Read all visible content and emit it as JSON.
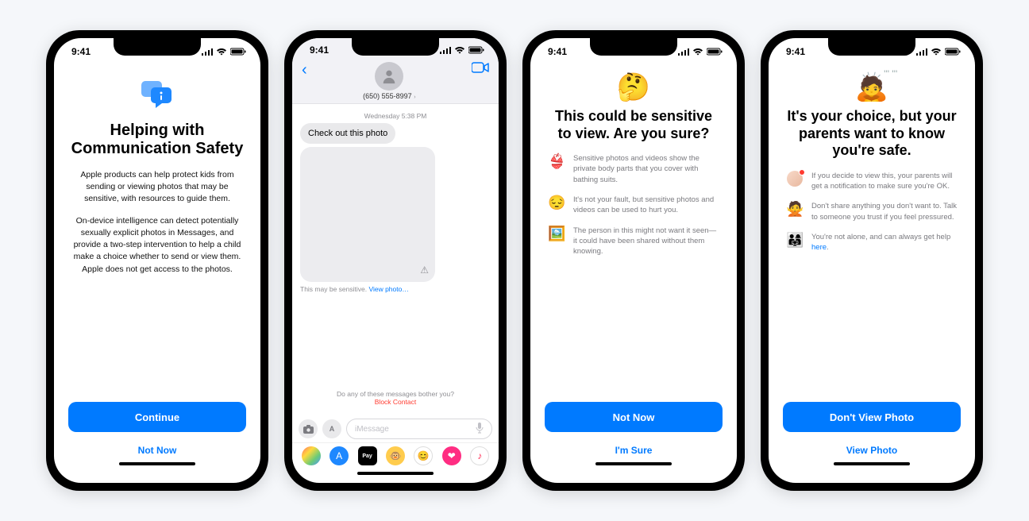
{
  "status": {
    "time": "9:41"
  },
  "screen1": {
    "title": "Helping with Communication Safety",
    "body1": "Apple products can help protect kids from sending or viewing photos that may be sensitive, with resources to guide them.",
    "body2": "On-device intelligence can detect potentially sexually explicit photos in Messages, and provide a two-step intervention to help a child make a choice whether to send or view them. Apple does not get access to the photos.",
    "primary": "Continue",
    "secondary": "Not Now"
  },
  "screen2": {
    "contact": "(650) 555-8997",
    "timestamp": "Wednesday 5:38 PM",
    "message": "Check out this photo",
    "sensitive_prefix": "This may be sensitive. ",
    "view_link": "View photo…",
    "bother": "Do any of these messages bother you?",
    "block": "Block Contact",
    "placeholder": "iMessage"
  },
  "screen3": {
    "emoji": "🤔",
    "title": "This could be sensitive to view. Are you sure?",
    "rows": [
      {
        "emoji": "👙",
        "text": "Sensitive photos and videos show the private body parts that you cover with bathing suits."
      },
      {
        "emoji": "😔",
        "text": "It's not your fault, but sensitive photos and videos can be used to hurt you."
      },
      {
        "emoji": "🖼️",
        "text": "The person in this might not want it seen—it could have been shared without them knowing."
      }
    ],
    "primary": "Not Now",
    "secondary": "I'm Sure"
  },
  "screen4": {
    "emoji": "🙇",
    "sweat": "💦",
    "title": "It's your choice, but your parents want to know you're safe.",
    "rows": [
      {
        "text": "If you decide to view this, your parents will get a notification to make sure you're OK."
      },
      {
        "emoji": "🙅",
        "text": "Don't share anything you don't want to. Talk to someone you trust if you feel pressured."
      },
      {
        "emoji": "👨‍👩‍👧",
        "text_prefix": "You're not alone, and can always get help ",
        "link": "here",
        "text_suffix": "."
      }
    ],
    "primary": "Don't View Photo",
    "secondary": "View Photo"
  }
}
